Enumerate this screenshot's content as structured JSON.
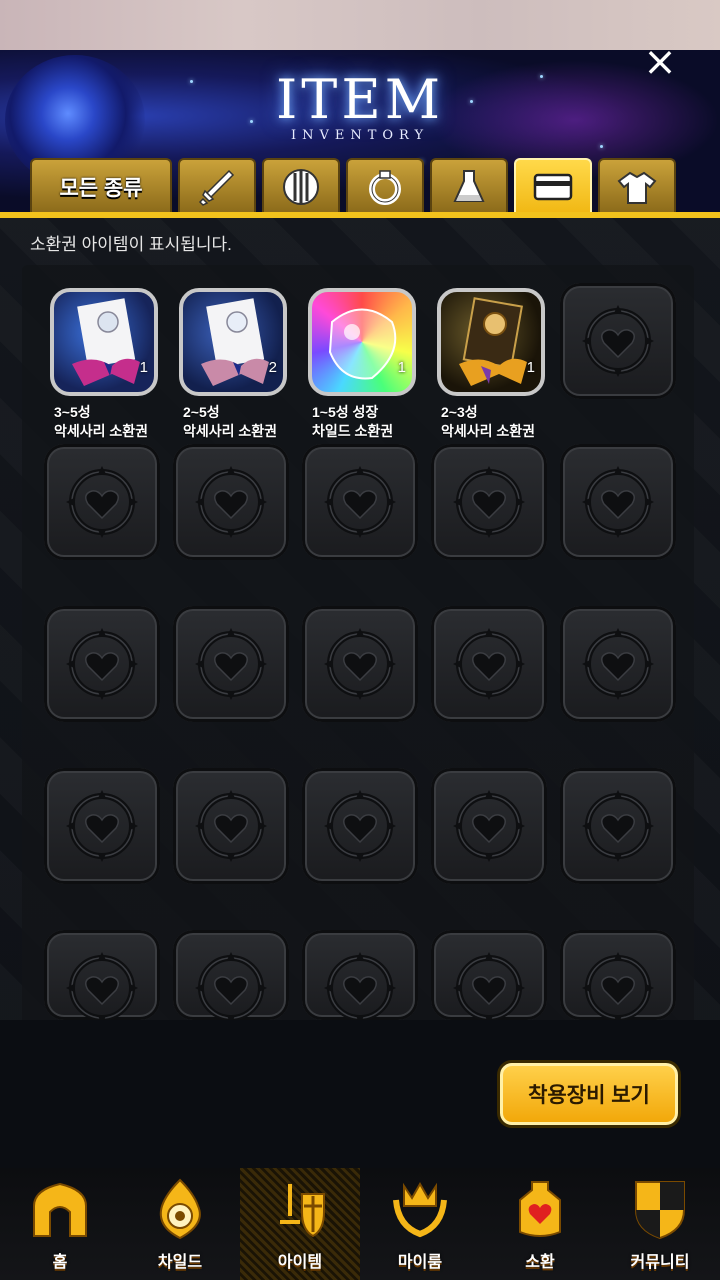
{
  "header": {
    "title": "ITEM",
    "subtitle": "INVENTORY"
  },
  "tabs": {
    "all_label": "모든 종류",
    "icons": [
      "sword-icon",
      "shield-icon",
      "ring-icon",
      "flask-icon",
      "ticket-icon",
      "shirt-icon"
    ],
    "active_icon": "ticket-icon"
  },
  "hint": "소환권 아이템이 표시됩니다.",
  "items": [
    {
      "line1": "3~5성",
      "line2": "악세사리 소환권",
      "qty": "1"
    },
    {
      "line1": "2~5성",
      "line2": "악세사리 소환권",
      "qty": "2"
    },
    {
      "line1": "1~5성 성장",
      "line2": "차일드 소환권",
      "qty": "1"
    },
    {
      "line1": "2~3성",
      "line2": "악세사리 소환권",
      "qty": "1"
    }
  ],
  "equip_button": "착용장비 보기",
  "nav": [
    {
      "label": "홈",
      "icon": "home-icon"
    },
    {
      "label": "차일드",
      "icon": "flame-icon"
    },
    {
      "label": "아이템",
      "icon": "item-icon"
    },
    {
      "label": "마이룸",
      "icon": "crown-icon"
    },
    {
      "label": "소환",
      "icon": "summon-icon"
    },
    {
      "label": "커뮤니티",
      "icon": "community-icon"
    }
  ],
  "colors": {
    "accent": "#f2c21c",
    "tab": "#caa23a",
    "tab_active": "#ffd94a"
  }
}
